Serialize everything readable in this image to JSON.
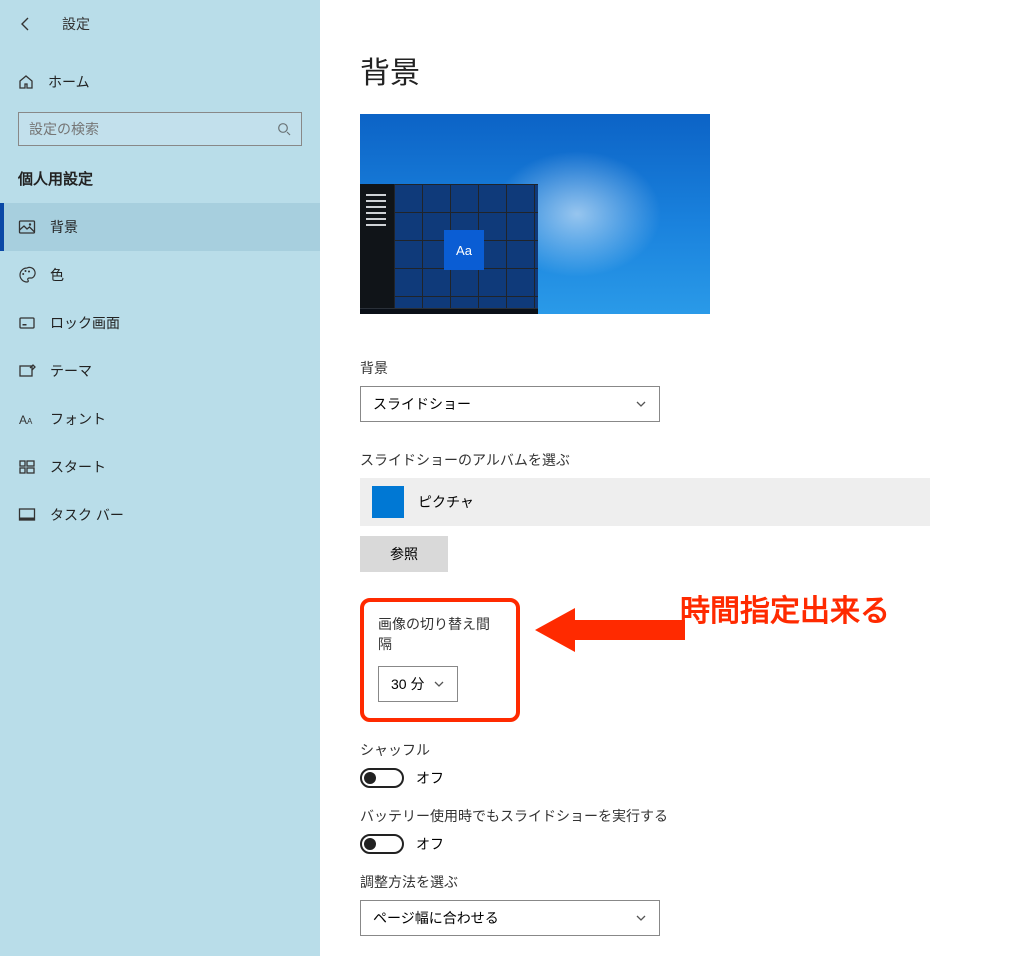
{
  "window": {
    "title": "設定"
  },
  "sidebar": {
    "home_label": "ホーム",
    "search_placeholder": "設定の検索",
    "category_title": "個人用設定",
    "items": [
      {
        "label": "背景",
        "active": true
      },
      {
        "label": "色"
      },
      {
        "label": "ロック画面"
      },
      {
        "label": "テーマ"
      },
      {
        "label": "フォント"
      },
      {
        "label": "スタート"
      },
      {
        "label": "タスク バー"
      }
    ]
  },
  "main": {
    "page_title": "背景",
    "preview_sample_text": "Aa",
    "background_label": "背景",
    "background_value": "スライドショー",
    "album_label": "スライドショーのアルバムを選ぶ",
    "album_value": "ピクチャ",
    "browse_label": "参照",
    "interval_label": "画像の切り替え間隔",
    "interval_value": "30 分",
    "shuffle_label": "シャッフル",
    "shuffle_value": "オフ",
    "battery_label": "バッテリー使用時でもスライドショーを実行する",
    "battery_value": "オフ",
    "fit_label": "調整方法を選ぶ",
    "fit_value": "ページ幅に合わせる"
  },
  "annotation": {
    "text": "時間指定出来る"
  },
  "colors": {
    "accent": "#0078d4",
    "highlight": "#ff2a00"
  }
}
